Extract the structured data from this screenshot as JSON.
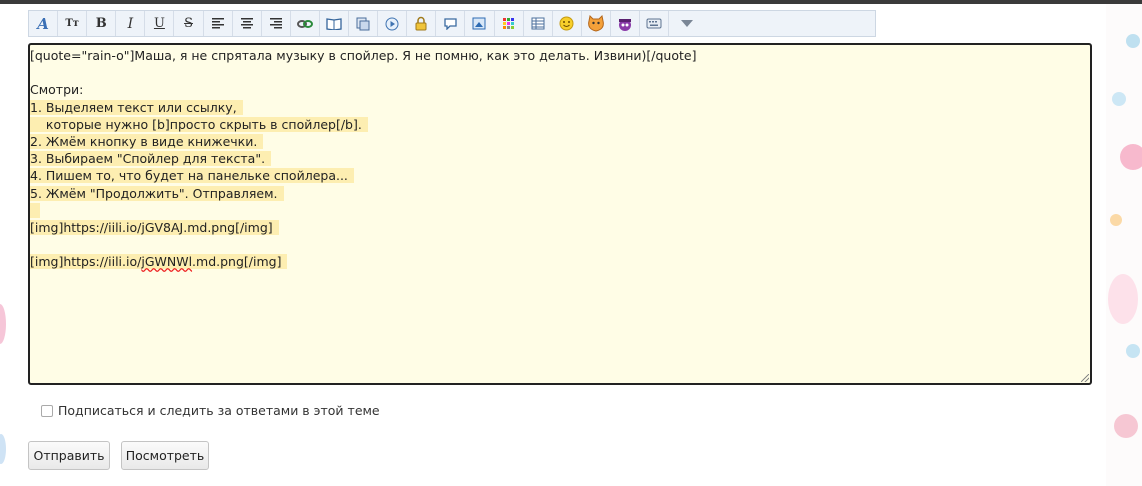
{
  "toolbar": {
    "buttons": [
      {
        "name": "font-color-icon",
        "glyph": "A",
        "tip": ""
      },
      {
        "name": "font-size-icon",
        "glyph": "Tт"
      },
      {
        "name": "bold-icon",
        "glyph": "B"
      },
      {
        "name": "italic-icon",
        "glyph": "I"
      },
      {
        "name": "underline-icon",
        "glyph": "U"
      },
      {
        "name": "strikethrough-icon",
        "glyph": "S"
      },
      {
        "name": "align-left-icon",
        "glyph": ""
      },
      {
        "name": "align-center-icon",
        "glyph": ""
      },
      {
        "name": "align-right-icon",
        "glyph": ""
      },
      {
        "name": "link-icon",
        "glyph": ""
      },
      {
        "name": "spoiler-book-icon",
        "glyph": ""
      },
      {
        "name": "quote-icon",
        "glyph": ""
      },
      {
        "name": "media-play-icon",
        "glyph": ""
      },
      {
        "name": "lock-icon",
        "glyph": ""
      },
      {
        "name": "speech-bubble-icon",
        "glyph": ""
      },
      {
        "name": "image-icon",
        "glyph": ""
      },
      {
        "name": "color-grid-icon",
        "glyph": ""
      },
      {
        "name": "table-icon",
        "glyph": ""
      },
      {
        "name": "smiley-icon",
        "glyph": ""
      },
      {
        "name": "cat-sticker-icon",
        "glyph": ""
      },
      {
        "name": "pirate-sticker-icon",
        "glyph": ""
      },
      {
        "name": "keyboard-icon",
        "glyph": ""
      },
      {
        "name": "more-dropdown-icon",
        "glyph": ""
      }
    ]
  },
  "editor": {
    "lines": [
      {
        "text": "[quote=\"rain-o\"]Маша, я не спрятала музыку в спойлер. Я не помню, как это делать. Извини)[/quote]",
        "hl": false
      },
      {
        "text": "",
        "hl": false
      },
      {
        "text": "Смотри:",
        "hl": false
      },
      {
        "text": "1. Выделяем текст или ссылку,",
        "hl": true
      },
      {
        "text": "    которые нужно [b]просто скрыть в спойлер[/b].",
        "hl": true
      },
      {
        "text": "2. Жмём кнопку в виде книжечки.",
        "hl": true
      },
      {
        "text": "3. Выбираем \"Спойлер для текста\".",
        "hl": true
      },
      {
        "text": "4. Пишем то, что будет на панельке спойлера...",
        "hl": true
      },
      {
        "text": "5. Жмём \"Продолжить\". Отправляем.",
        "hl": true
      },
      {
        "text": "",
        "hl": true
      },
      {
        "text": "[img]https://iili.io/jGV8AJ.md.png[/img]",
        "hl": true
      },
      {
        "text": "",
        "hl": false
      },
      {
        "text": "[img]https://iili.io/jGWNWl.md.png[/img]",
        "hl": true
      }
    ],
    "last_line_prefix": "[img]https://iili.io/",
    "last_line_misspelled": "jGWNWl",
    "last_line_suffix": ".md.png[/img]"
  },
  "subscribe": {
    "label": "Подписаться и следить за ответами в этой теме",
    "checked": false
  },
  "buttons": {
    "submit": "Отправить",
    "preview": "Посмотреть"
  },
  "colors": {
    "editor_bg": "#fffde6",
    "highlight": "#fdeeb1",
    "toolbar_bg": "#eef3f9"
  }
}
